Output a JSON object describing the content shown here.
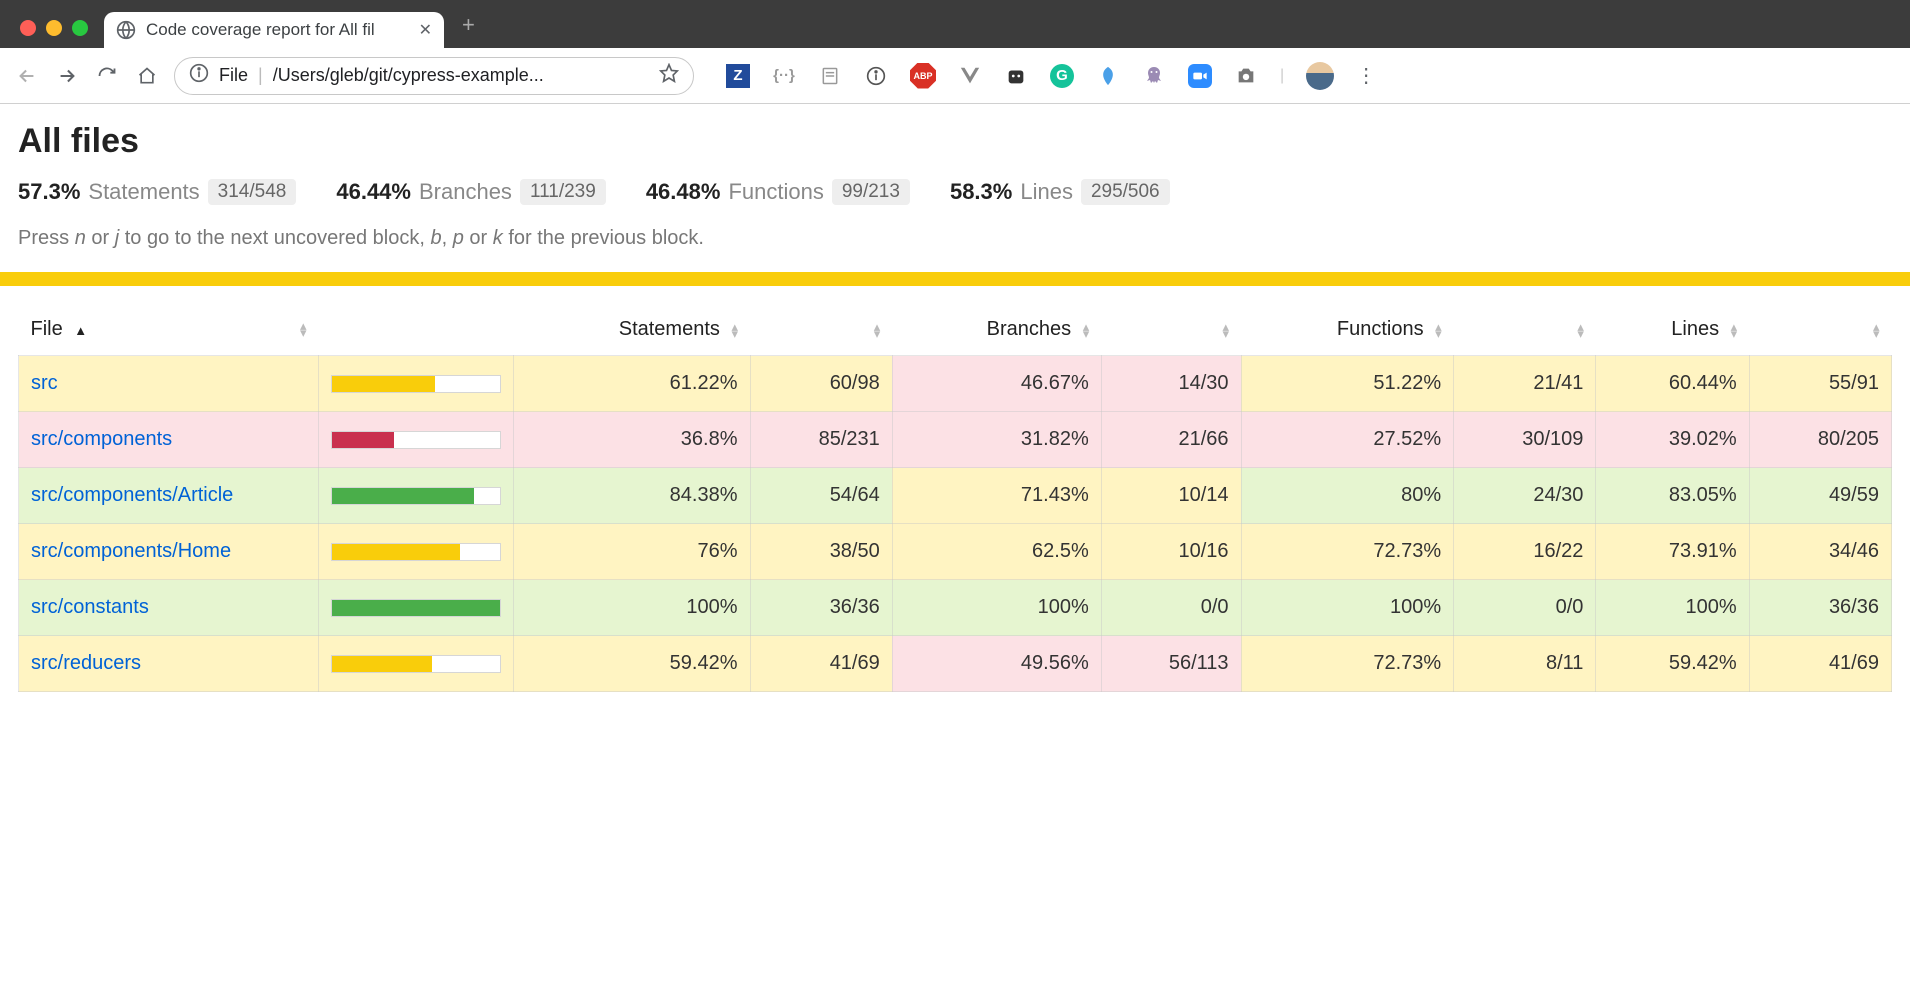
{
  "browser": {
    "tab_title": "Code coverage report for All fil",
    "url_scheme": "File",
    "url_path": "/Users/gleb/git/cypress-example..."
  },
  "page": {
    "title": "All files",
    "help_prefix": "Press ",
    "help_mid1": " or ",
    "help_mid2": " to go to the next uncovered block, ",
    "help_mid3": ", ",
    "help_mid4": " or ",
    "help_suffix": " for the previous block.",
    "key_n": "n",
    "key_j": "j",
    "key_b": "b",
    "key_p": "p",
    "key_k": "k"
  },
  "summary": {
    "statements": {
      "pct": "57.3%",
      "label": "Statements",
      "frac": "314/548"
    },
    "branches": {
      "pct": "46.44%",
      "label": "Branches",
      "frac": "111/239"
    },
    "functions": {
      "pct": "46.48%",
      "label": "Functions",
      "frac": "99/213"
    },
    "lines": {
      "pct": "58.3%",
      "label": "Lines",
      "frac": "295/506"
    }
  },
  "headers": {
    "file": "File",
    "statements": "Statements",
    "branches": "Branches",
    "functions": "Functions",
    "lines": "Lines"
  },
  "rows": [
    {
      "file": "src",
      "bar_pct": 61.22,
      "bar_level": "med",
      "statements": {
        "pct": "61.22%",
        "frac": "60/98",
        "level": "med"
      },
      "branches": {
        "pct": "46.67%",
        "frac": "14/30",
        "level": "low"
      },
      "functions": {
        "pct": "51.22%",
        "frac": "21/41",
        "level": "med"
      },
      "lines": {
        "pct": "60.44%",
        "frac": "55/91",
        "level": "med"
      }
    },
    {
      "file": "src/components",
      "bar_pct": 36.8,
      "bar_level": "low",
      "statements": {
        "pct": "36.8%",
        "frac": "85/231",
        "level": "low"
      },
      "branches": {
        "pct": "31.82%",
        "frac": "21/66",
        "level": "low"
      },
      "functions": {
        "pct": "27.52%",
        "frac": "30/109",
        "level": "low"
      },
      "lines": {
        "pct": "39.02%",
        "frac": "80/205",
        "level": "low"
      }
    },
    {
      "file": "src/components/Article",
      "bar_pct": 84.38,
      "bar_level": "high",
      "statements": {
        "pct": "84.38%",
        "frac": "54/64",
        "level": "high"
      },
      "branches": {
        "pct": "71.43%",
        "frac": "10/14",
        "level": "med"
      },
      "functions": {
        "pct": "80%",
        "frac": "24/30",
        "level": "high"
      },
      "lines": {
        "pct": "83.05%",
        "frac": "49/59",
        "level": "high"
      }
    },
    {
      "file": "src/components/Home",
      "bar_pct": 76,
      "bar_level": "med",
      "statements": {
        "pct": "76%",
        "frac": "38/50",
        "level": "med"
      },
      "branches": {
        "pct": "62.5%",
        "frac": "10/16",
        "level": "med"
      },
      "functions": {
        "pct": "72.73%",
        "frac": "16/22",
        "level": "med"
      },
      "lines": {
        "pct": "73.91%",
        "frac": "34/46",
        "level": "med"
      }
    },
    {
      "file": "src/constants",
      "bar_pct": 100,
      "bar_level": "high",
      "statements": {
        "pct": "100%",
        "frac": "36/36",
        "level": "high"
      },
      "branches": {
        "pct": "100%",
        "frac": "0/0",
        "level": "high"
      },
      "functions": {
        "pct": "100%",
        "frac": "0/0",
        "level": "high"
      },
      "lines": {
        "pct": "100%",
        "frac": "36/36",
        "level": "high"
      }
    },
    {
      "file": "src/reducers",
      "bar_pct": 59.42,
      "bar_level": "med",
      "statements": {
        "pct": "59.42%",
        "frac": "41/69",
        "level": "med"
      },
      "branches": {
        "pct": "49.56%",
        "frac": "56/113",
        "level": "low"
      },
      "functions": {
        "pct": "72.73%",
        "frac": "8/11",
        "level": "med"
      },
      "lines": {
        "pct": "59.42%",
        "frac": "41/69",
        "level": "med"
      }
    }
  ]
}
